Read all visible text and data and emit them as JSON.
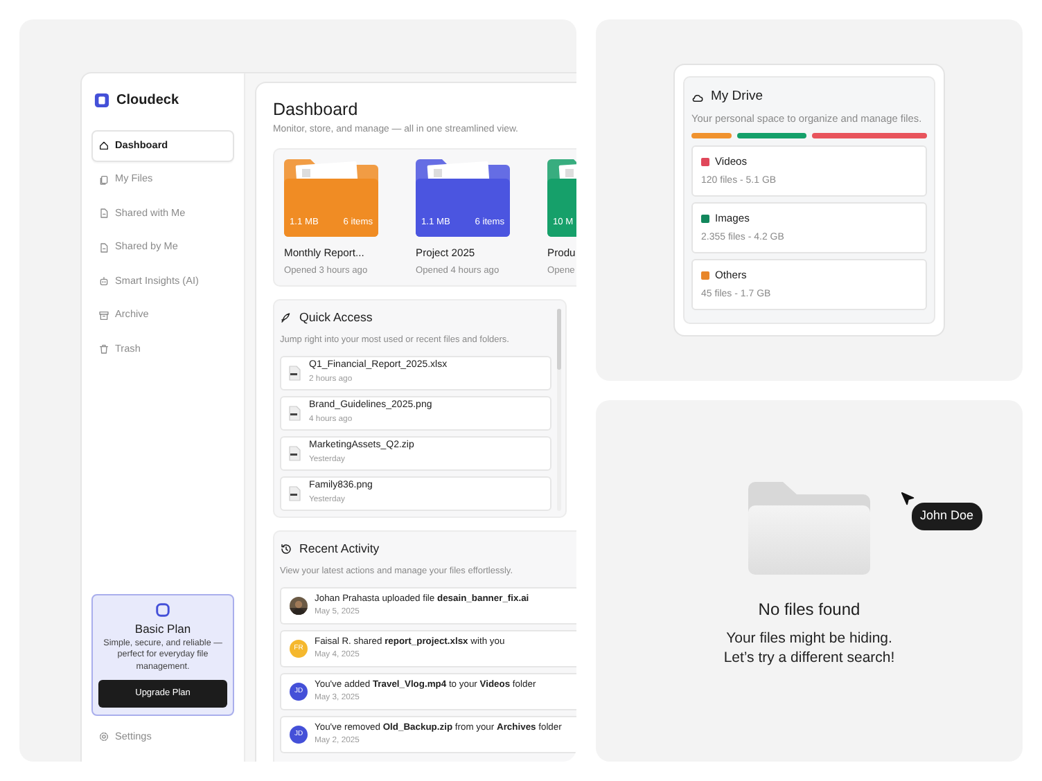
{
  "brand": {
    "name": "Cloudeck"
  },
  "sidebar": {
    "items": [
      {
        "label": "Dashboard",
        "kind": "home",
        "selected": true
      },
      {
        "label": "My Files",
        "kind": "files",
        "selected": false
      },
      {
        "label": "Shared with Me",
        "kind": "file",
        "selected": false
      },
      {
        "label": "Shared by Me",
        "kind": "file",
        "selected": false
      },
      {
        "label": "Smart Insights (AI)",
        "kind": "robot",
        "selected": false
      },
      {
        "label": "Archive",
        "kind": "archive",
        "selected": false
      },
      {
        "label": "Trash",
        "kind": "trash",
        "selected": false
      }
    ],
    "plan": {
      "title": "Basic Plan",
      "text": "Simple, secure, and reliable — perfect for everyday file management.",
      "button": "Upgrade Plan"
    },
    "footer": {
      "label": "Settings",
      "kind": "gear"
    }
  },
  "dashboard": {
    "title": "Dashboard",
    "subtitle": "Monitor, store, and manage — all in one streamlined view.",
    "folders": [
      {
        "color": "#f08c24",
        "size": "1.1 MB",
        "count": "6 items",
        "name": "Monthly Report...",
        "opened": "Opened 3 hours ago"
      },
      {
        "color": "#4b55e0",
        "size": "1.1 MB",
        "count": "6 items",
        "name": "Project 2025",
        "opened": "Opened 4 hours ago"
      },
      {
        "color": "#16a06a",
        "size": "10 M",
        "name": "Produ",
        "opened": "Opene"
      }
    ]
  },
  "quick_access": {
    "title": "Quick Access",
    "subtitle": "Jump right into your most used or recent files and folders.",
    "files": [
      {
        "name": "Q1_Financial_Report_2025.xlsx",
        "time": "2 hours ago"
      },
      {
        "name": "Brand_Guidelines_2025.png",
        "time": "4 hours ago"
      },
      {
        "name": "MarketingAssets_Q2.zip",
        "time": "Yesterday"
      },
      {
        "name": "Family836.png",
        "time": "Yesterday"
      }
    ]
  },
  "recent_activity": {
    "title": "Recent Activity",
    "subtitle": "View your latest actions and manage your files effortlessly.",
    "items": [
      {
        "text": "Johan Prahasta uploaded file **desain_banner_fix.ai**",
        "date": "May 5, 2025"
      },
      {
        "avatar": {
          "kind": "initials",
          "initials": "FR",
          "color": "#f5b82e"
        },
        "text": "Faisal R. shared **report_project.xlsx** with you",
        "date": "May 4, 2025"
      },
      {
        "avatar": {
          "kind": "initials",
          "initials": "JD",
          "color": "#4450d8"
        },
        "text": "You've added **Travel_Vlog.mp4** to your **Videos** folder",
        "date": "May 3, 2025"
      },
      {
        "avatar": {
          "kind": "initials",
          "initials": "JD",
          "color": "#4450d8"
        },
        "text": "You've removed **Old_Backup.zip** from your **Archives** folder",
        "date": "May 2, 2025"
      }
    ]
  },
  "drive": {
    "title": "My Drive",
    "subtitle": "Your personal space to organize and manage files.",
    "usage_bar": [
      {
        "color": "#f0922e",
        "level": 0.18
      },
      {
        "color": "#14a06a",
        "level": 0.31
      },
      {
        "color": "#e8545c",
        "level": 0.51
      }
    ],
    "categories": [
      {
        "name": "Videos",
        "color": "#e0475a",
        "detail": "120 files - 5.1 GB"
      },
      {
        "name": "Images",
        "color": "#12875c",
        "detail": "2.355 files - 4.2 GB"
      },
      {
        "name": "Others",
        "color": "#e8862a",
        "detail": "45 files - 1.7 GB"
      }
    ]
  },
  "empty_state": {
    "title": "No files found",
    "message": "Your files might be hiding.\nLet’s try a different search!"
  },
  "tooltip": {
    "label": "John Doe"
  }
}
